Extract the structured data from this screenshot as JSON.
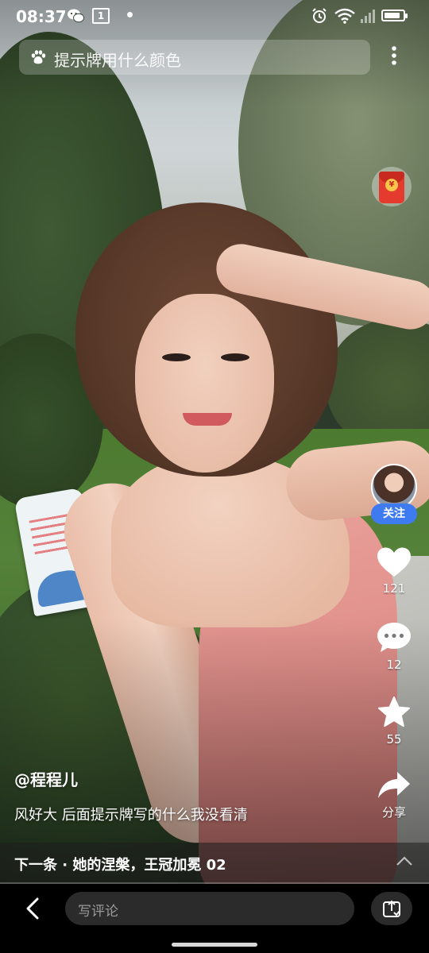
{
  "status_bar": {
    "time": "08:37",
    "sim_label": "1",
    "battery_level": 0.85,
    "icons": [
      "wechat-icon",
      "sim-card-icon",
      "notification-dot-icon",
      "alarm-icon",
      "wifi-icon",
      "signal-icon",
      "battery-icon"
    ]
  },
  "search": {
    "text": "提示牌用什么颜色",
    "icon": "baidu-paw-icon"
  },
  "red_packet": {
    "coin_symbol": "¥",
    "icon": "red-packet-icon"
  },
  "creator": {
    "follow_label": "关注"
  },
  "actions": {
    "like_count": "121",
    "comment_count": "12",
    "favorite_count": "55",
    "share_label": "分享"
  },
  "post": {
    "username": "@程程儿",
    "caption": "风好大 后面提示牌写的什么我没看清"
  },
  "next": {
    "label": "下一条 · 她的涅槃，王冠加冕 02"
  },
  "comment_bar": {
    "placeholder": "写评论"
  },
  "colors": {
    "follow_button": "#3f7bf0",
    "red_packet": "#e53b2e",
    "bottom_bar": "#000000"
  }
}
